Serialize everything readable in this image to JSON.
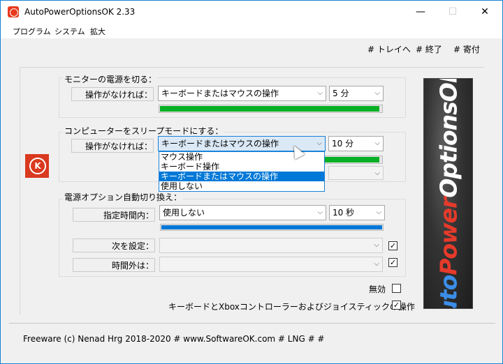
{
  "window": {
    "title": "AutoPowerOptionsOK 2.33",
    "buttons": {
      "minimize": "—",
      "maximize": "☐",
      "close": "✕"
    }
  },
  "menu": {
    "items": [
      "プログラム",
      "システム",
      "拡大"
    ]
  },
  "toplinks": {
    "tray": "# トレイへ",
    "exit": "# 終了",
    "donate": "# 寄付"
  },
  "monitor": {
    "group_label": "モニターの電源を切る：",
    "row_label": "操作がなければ：",
    "mode_value": "キーボードまたはマウスの操作",
    "time_value": "5 分",
    "progress": 0.99,
    "progress_color": "#06b025"
  },
  "sleep": {
    "group_label": "コンピューターをスリープモードにする：",
    "row_label": "操作がなければ：",
    "mode_value": "キーボードまたはマウスの操作",
    "time_value": "10 分",
    "progress": 0.99,
    "progress_color": "#06b025",
    "dropdown_options": [
      "マウス操作",
      "キーボード操作",
      "キーボードまたはマウスの操作",
      "使用しない"
    ],
    "dropdown_selected_index": 2
  },
  "auto_switch": {
    "group_label": "電源オプション自動切り換え：",
    "schedule_label": "指定時間内：",
    "schedule_value": "使用しない",
    "schedule_time": "10 秒",
    "progress": 1.0,
    "progress_color": "#0078d7",
    "next_label": "次を設定：",
    "next_checked": true,
    "outside_label": "時間外は：",
    "outside_checked": true
  },
  "options": {
    "disable_label": "無効",
    "disable_checked": false,
    "controller_label": "キーボードとXboxコントローラーおよびジョイスティックの操作",
    "controller_checked": true
  },
  "banner": {
    "auto": "Auto",
    "power": "Power",
    "options": "OptionsOK",
    "dots": "......"
  },
  "footer": {
    "text": "Freeware (c) Nenad Hrg 2018-2020 # www.SoftwareOK.com    # LNG    #    #"
  }
}
